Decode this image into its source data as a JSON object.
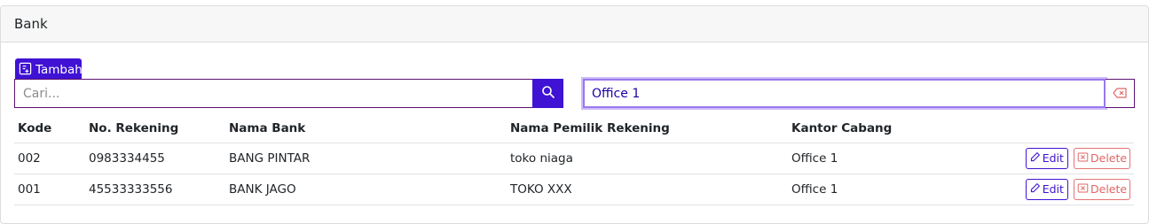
{
  "header": {
    "title": "Bank"
  },
  "toolbar": {
    "add_label": "Tambah"
  },
  "search": {
    "placeholder": "Cari...",
    "value": ""
  },
  "filter": {
    "value": "Office 1"
  },
  "table": {
    "columns": [
      "Kode",
      "No. Rekening",
      "Nama Bank",
      "Nama Pemilik Rekening",
      "Kantor Cabang"
    ],
    "rows": [
      {
        "kode": "002",
        "rekening": "0983334455",
        "bank": "BANG PINTAR",
        "pemilik": "toko niaga",
        "kantor": "Office 1"
      },
      {
        "kode": "001",
        "rekening": "45533333556",
        "bank": "BANK JAGO",
        "pemilik": "TOKO XXX",
        "kantor": "Office 1"
      }
    ],
    "edit_label": "Edit",
    "delete_label": "Delete"
  },
  "colors": {
    "primary": "#3f12d4",
    "danger": "#e06666",
    "border": "#5b1170"
  },
  "icons": {
    "add": "note-add-icon",
    "search": "search-icon",
    "clear": "backspace-icon",
    "edit": "pencil-icon",
    "delete": "x-square-icon"
  }
}
